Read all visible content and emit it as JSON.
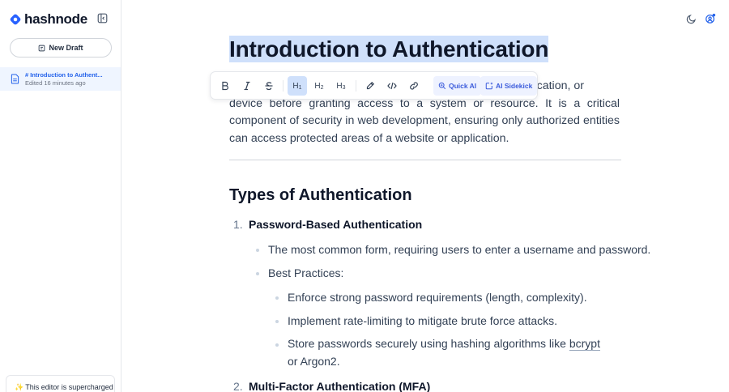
{
  "brand": {
    "name": "hashnode",
    "color": "#2962ff"
  },
  "sidebar": {
    "new_draft_label": "New Draft",
    "drafts": [
      {
        "title": "# Introduction to Authent...",
        "meta": "Edited 16 minutes ago"
      }
    ],
    "promo_text": "This editor is supercharged"
  },
  "toolbar": {
    "buttons": [
      "bold",
      "italic",
      "strikethrough",
      "heading-1",
      "heading-2",
      "heading-3",
      "highlight",
      "code",
      "link"
    ],
    "active": "heading-1",
    "h1_label": "H",
    "h1_sub": "1",
    "h2_label": "H",
    "h2_sub": "2",
    "h3_label": "H",
    "h3_sub": "3",
    "quick_ai_label": "Quick AI",
    "sidekick_label": "AI Sidekick"
  },
  "document": {
    "title": "Introduction to Authentication",
    "intro_partial_first_line": "lication, or",
    "intro_rest": "device before granting access to a system or resource. It is a critical component of security in web development, ensuring only authorized entities can access protected areas of a website or application.",
    "section_heading": "Types of Authentication",
    "items": [
      {
        "number": "1.",
        "title": "Password-Based Authentication",
        "bullets": [
          "The most common form, requiring users to enter a username and password.",
          "Best Practices:"
        ],
        "sub_bullets": [
          "Enforce strong password requirements (length, complexity).",
          "Implement rate-limiting to mitigate brute force attacks.",
          "Store passwords securely using hashing algorithms like "
        ],
        "sub_bullet_underlined": "bcrypt",
        "sub_bullet_tail": " or Argon2."
      },
      {
        "number": "2.",
        "title": "Multi-Factor Authentication (MFA)"
      }
    ]
  },
  "colors": {
    "accent": "#2563eb",
    "selection": "#cfe0fb",
    "active_draft_bg": "#eff5ff"
  }
}
